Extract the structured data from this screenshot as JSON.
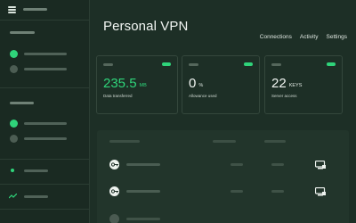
{
  "window": {
    "title": "Personal VPN"
  },
  "nav": [
    {
      "label": "Connections"
    },
    {
      "label": "Activity"
    },
    {
      "label": "Settings"
    }
  ],
  "stats": [
    {
      "value": "235.5",
      "unit": "MB",
      "caption": "Data transferred"
    },
    {
      "value": "0",
      "unit": "%",
      "caption": "Allowance used"
    },
    {
      "value": "22",
      "unit": "KEYS",
      "caption": "Server access"
    }
  ],
  "colors": {
    "accent": "#2fd47a",
    "background": "#1d2f26",
    "sidebar": "#1a2a22",
    "card_border": "#34473c",
    "table_bg": "#22352b"
  },
  "icons": {
    "menu": "hamburger-menu-icon",
    "key": "key-icon",
    "row_action": "monitor-edit-icon",
    "status_dot": "status-dot-icon",
    "activity_line": "line-chart-icon"
  }
}
